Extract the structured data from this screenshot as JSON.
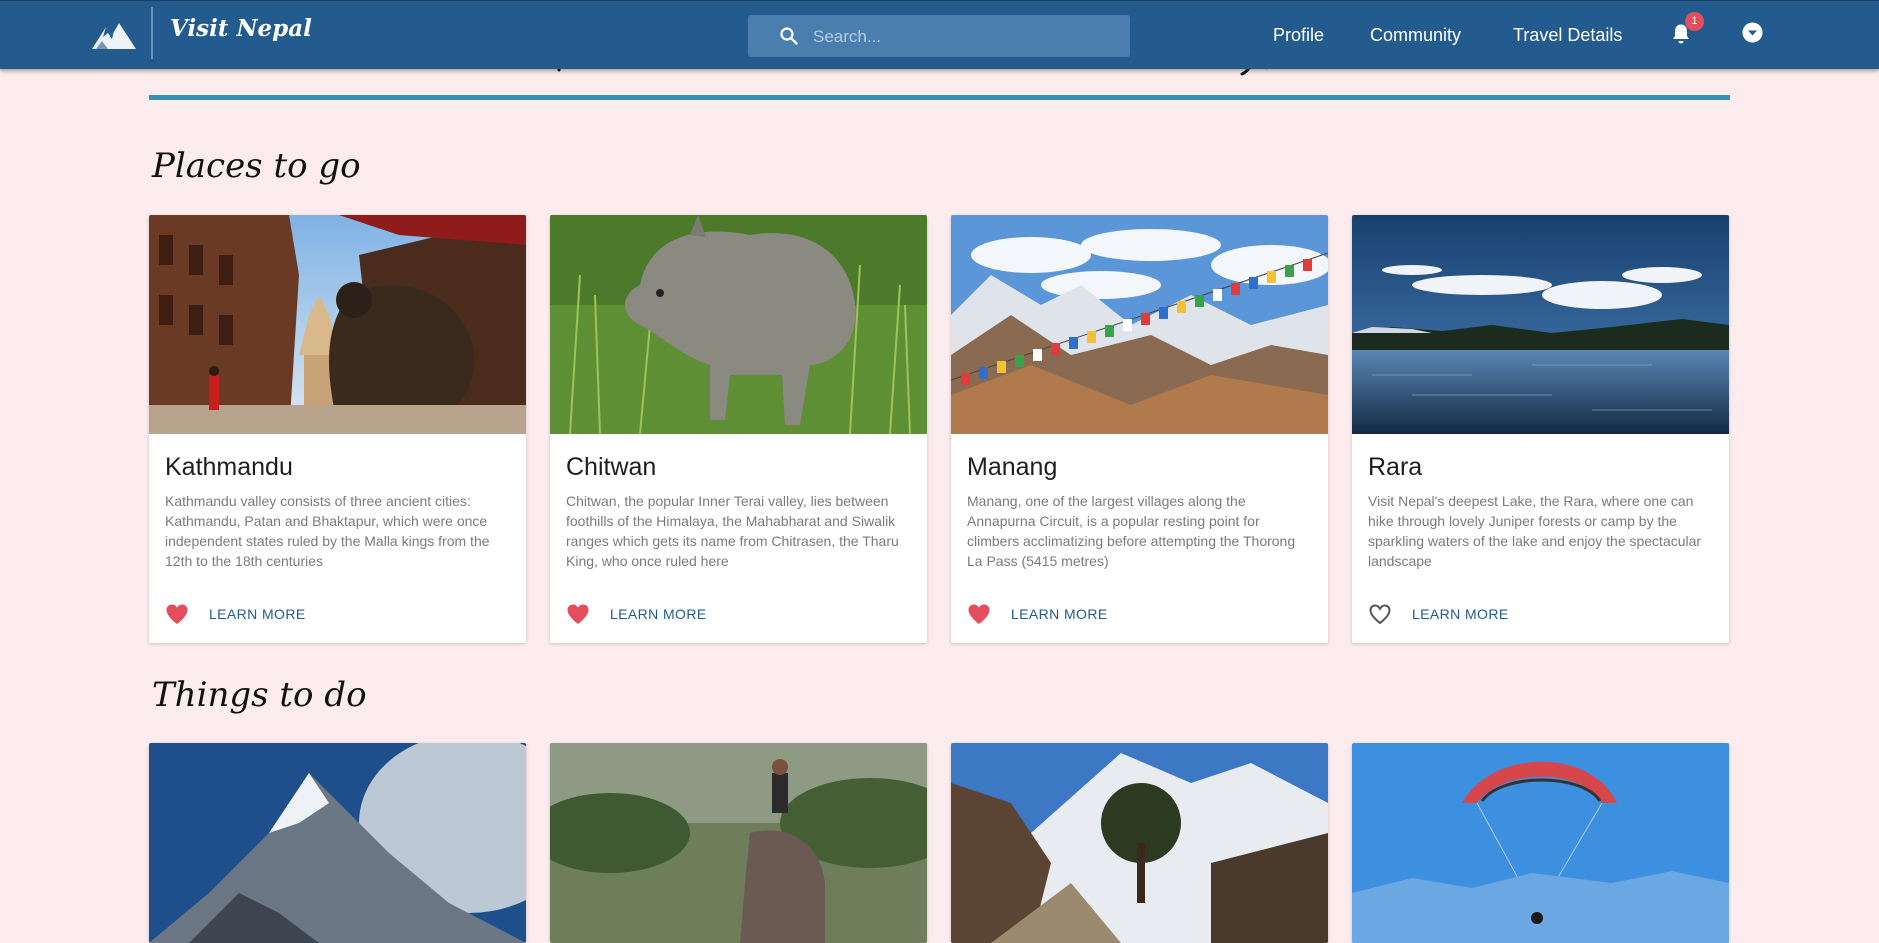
{
  "navbar": {
    "brand": "Visit Nepal",
    "search_placeholder": "Search...",
    "links": [
      "Profile",
      "Community",
      "Travel Details"
    ],
    "notification_count": "1"
  },
  "places": {
    "title": "Places to go",
    "cards": [
      {
        "title": "Kathmandu",
        "description": "Kathmandu valley consists of three ancient cities: Kathmandu, Patan and Bhaktapur, which were once independent states ruled by the Malla kings from the 12th to the 18th centuries",
        "action": "LEARN MORE",
        "liked": true
      },
      {
        "title": "Chitwan",
        "description": "Chitwan, the popular Inner Terai valley, lies between foothills of the Himalaya, the Mahabharat and Siwalik ranges which gets its name from Chitrasen, the Tharu King, who once ruled here",
        "action": "LEARN MORE",
        "liked": true
      },
      {
        "title": "Manang",
        "description": "Manang, one of the largest villages along the Annapurna Circuit, is a popular resting point for climbers acclimatizing before attempting the Thorong La Pass (5415 metres)",
        "action": "LEARN MORE",
        "liked": true
      },
      {
        "title": "Rara",
        "description": "Visit Nepal's deepest Lake, the Rara, where one can hike through lovely Juniper forests or camp by the sparkling waters of the lake and enjoy the spectacular landscape",
        "action": "LEARN MORE",
        "liked": false
      }
    ]
  },
  "things": {
    "title": "Things to do"
  },
  "colors": {
    "navbar": "#235b8e",
    "page_background": "#fdeced",
    "accent_rule": "#3490b8",
    "heart": "#e34d5c",
    "link": "#235b8e"
  },
  "icons": {
    "logo": "mountain-logo-icon",
    "search": "search-icon",
    "notifications": "bell-icon",
    "account": "chevron-down-circle-icon",
    "liked": "heart-filled-icon",
    "not_liked": "heart-outline-icon"
  }
}
